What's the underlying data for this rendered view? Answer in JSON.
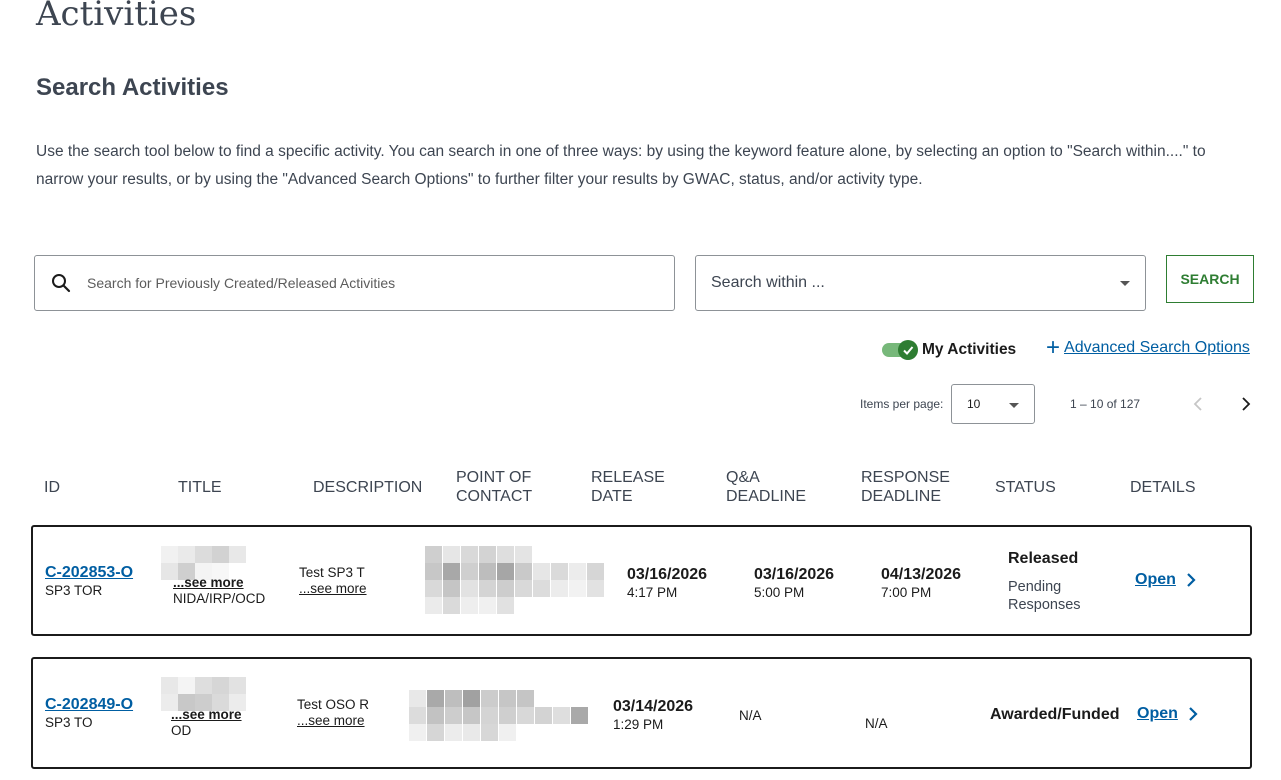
{
  "page": {
    "title": "Activities",
    "section_title": "Search Activities",
    "intro": "Use the search tool below to find a specific activity. You can search in one of three ways: by using the keyword feature alone, by selecting an option to \"Search within....\" to narrow your results, or by using the \"Advanced Search Options\" to further filter your results by GWAC, status, and/or activity type."
  },
  "search": {
    "placeholder": "Search for Previously Created/Released Activities",
    "within_placeholder": "Search within ...",
    "button_label": "SEARCH"
  },
  "filters": {
    "my_activities_label": "My Activities",
    "my_activities_on": true,
    "advanced_label": "Advanced Search Options"
  },
  "pagination": {
    "items_per_page_label": "Items per page:",
    "items_per_page": "10",
    "range": "1 – 10 of 127"
  },
  "table": {
    "headers": {
      "id": "ID",
      "title": "TITLE",
      "description": "DESCRIPTION",
      "poc": "POINT OF CONTACT",
      "release": "RELEASE DATE",
      "qa": "Q&A DEADLINE",
      "response": "RESPONSE DEADLINE",
      "status": "STATUS",
      "details": "DETAILS"
    },
    "rows": [
      {
        "id": "C-202853-O",
        "type": "SP3 TOR",
        "title_see_more": "...see more",
        "title_org": "NIDA/IRP/OCD",
        "description": "Test SP3 T",
        "desc_see_more": "...see more",
        "release_date": "03/16/2026",
        "release_time": "4:17 PM",
        "qa_date": "03/16/2026",
        "qa_time": "5:00 PM",
        "response_date": "04/13/2026",
        "response_time": "7:00 PM",
        "status": "Released",
        "status_sub": "Pending Responses",
        "details": "Open"
      },
      {
        "id": "C-202849-O",
        "type": "SP3 TO",
        "title_see_more": "...see more",
        "title_org": "OD",
        "description": "Test OSO R",
        "desc_see_more": "...see more",
        "release_date": "03/14/2026",
        "release_time": "1:29 PM",
        "qa": "N/A",
        "response": "N/A",
        "status": "Awarded/Funded",
        "details": "Open"
      }
    ]
  },
  "colors": {
    "link": "#005ea2",
    "accent_green": "#2e7d32",
    "text_dark": "#1b1b1b",
    "text_muted": "#3d4551"
  },
  "icons": {
    "search": "search-icon",
    "dropdown": "chevron-down-icon",
    "toggle": "check-icon",
    "add": "plus-icon",
    "prev": "chevron-left-icon",
    "next": "chevron-right-icon",
    "open": "chevron-right-icon"
  }
}
